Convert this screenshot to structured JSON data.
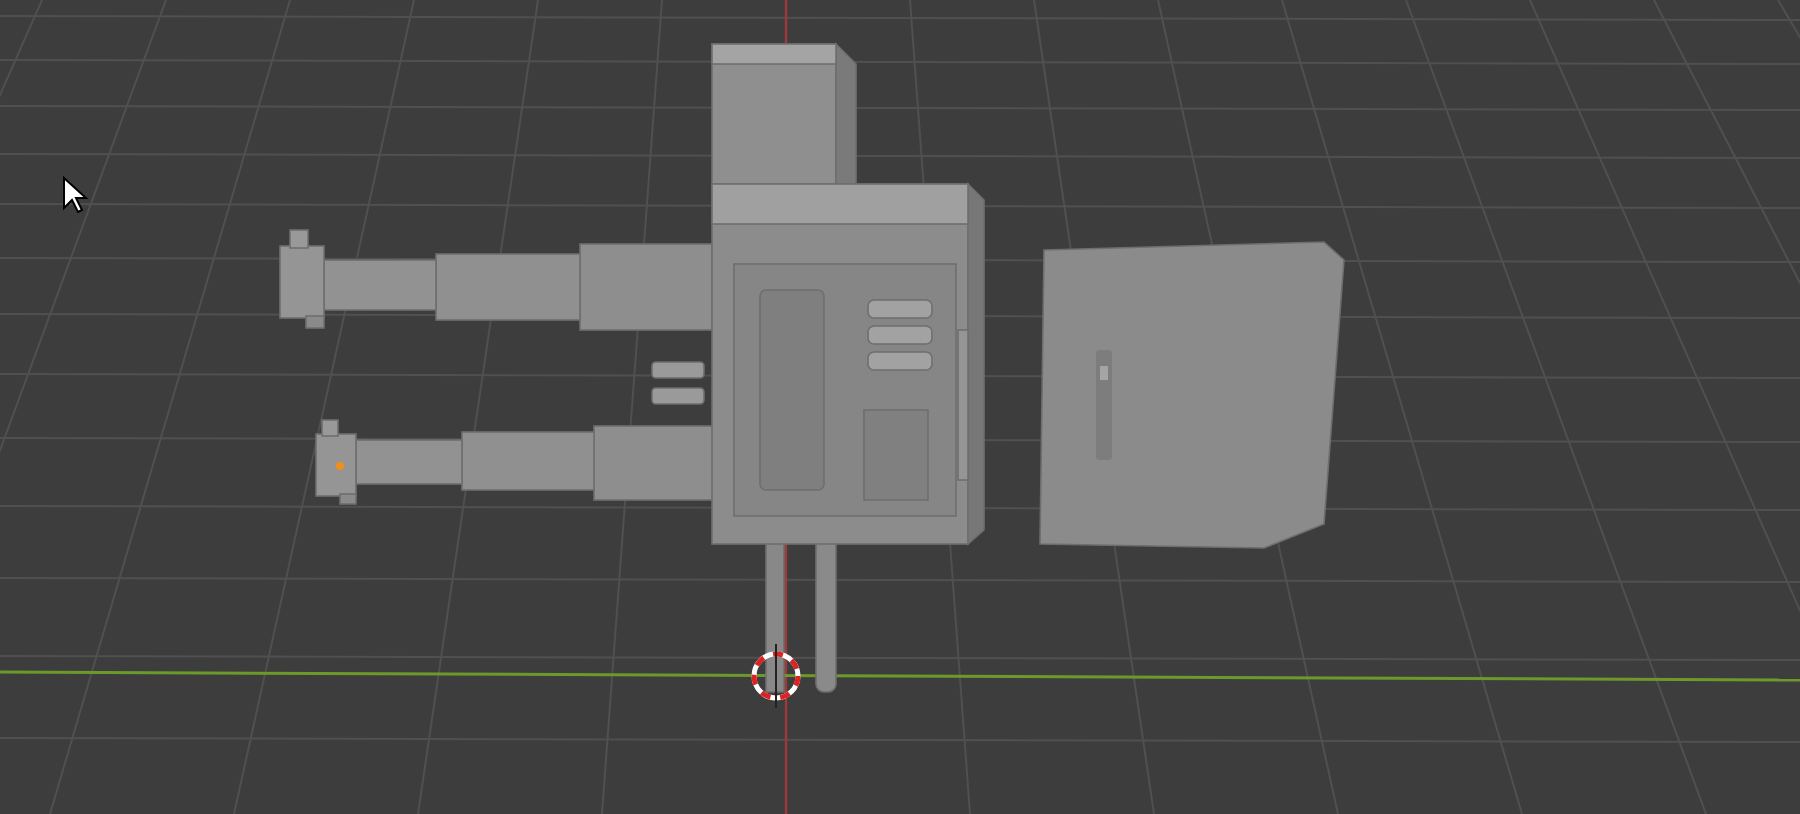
{
  "viewport": {
    "cursor_3d": true,
    "mouse_pointer": true
  }
}
